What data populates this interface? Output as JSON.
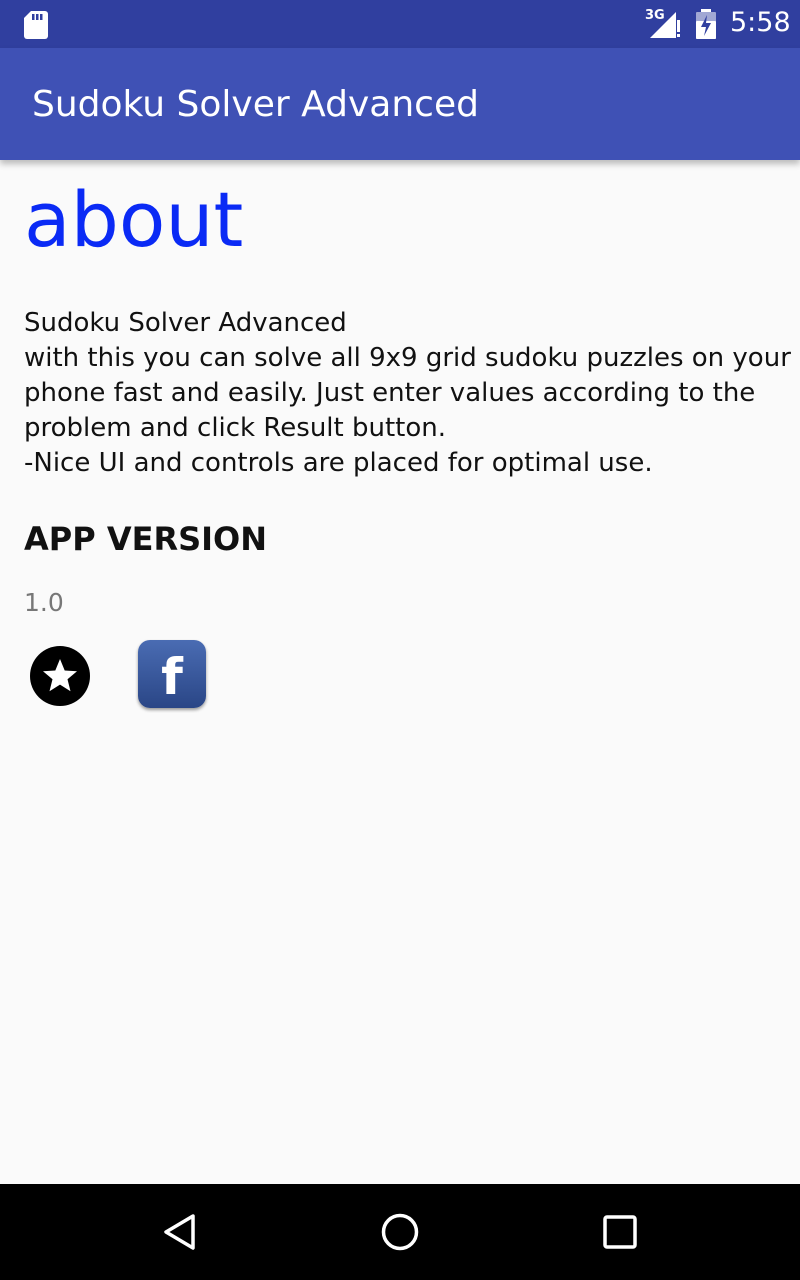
{
  "status_bar": {
    "network": "3G",
    "time": "5:58",
    "icons": [
      "sd-card-icon",
      "signal-icon",
      "battery-charging-icon"
    ]
  },
  "app_bar": {
    "title": "Sudoku Solver Advanced"
  },
  "about": {
    "heading": "about",
    "description": "Sudoku Solver Advanced\n with this you can solve all 9x9 grid sudoku puzzles on your phone fast and easily. Just enter values according to the problem and click Result button.\n -Nice UI and controls are placed for optimal use.",
    "version_label": "APP VERSION",
    "version_value": "1.0",
    "actions": [
      {
        "name": "rate",
        "icon": "star-icon"
      },
      {
        "name": "facebook",
        "icon": "facebook-icon",
        "letter": "f"
      }
    ]
  },
  "nav_bar": {
    "buttons": [
      "back",
      "home",
      "recents"
    ]
  },
  "colors": {
    "status_bar": "#303f9f",
    "app_bar": "#3f51b5",
    "heading": "#0a2af5",
    "background": "#fafafa"
  }
}
